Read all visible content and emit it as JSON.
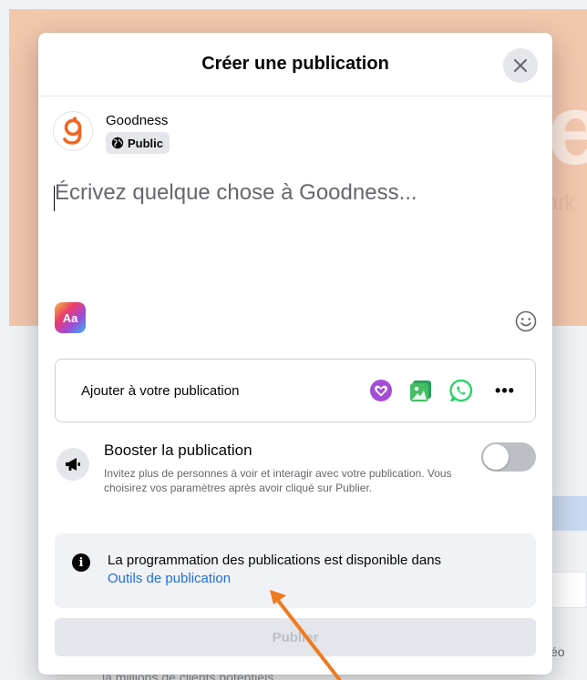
{
  "background": {
    "big_letter": "e",
    "side_text": "ark",
    "video_text": "éo",
    "bottom_text": "la millions de clients potentiels"
  },
  "modal": {
    "title": "Créer une publication",
    "close_icon": "close-icon"
  },
  "author": {
    "name": "Goodness",
    "audience_label": "Public",
    "audience_icon": "globe-icon"
  },
  "composer": {
    "placeholder": "Écrivez quelque chose à Goodness...",
    "text_style_label": "Aa"
  },
  "add_to_post": {
    "label": "Ajouter à votre publication",
    "icons": [
      "feeling-icon",
      "photo-video-icon",
      "whatsapp-icon",
      "more-icon"
    ],
    "more_label": "•••"
  },
  "boost": {
    "title": "Booster la publication",
    "description": "Invitez plus de personnes à voir et interagir avec votre publication. Vous choisirez vos paramètres après avoir cliqué sur Publier.",
    "toggle_on": false
  },
  "info": {
    "icon": "info-icon",
    "text": "La programmation des publications est disponible dans",
    "link": "Outils de publication"
  },
  "publish": {
    "label": "Publier",
    "enabled": false
  },
  "colors": {
    "accent": "#216fdb",
    "annotation_arrow": "#ee7b1e",
    "brand_logo": "#f26522"
  }
}
